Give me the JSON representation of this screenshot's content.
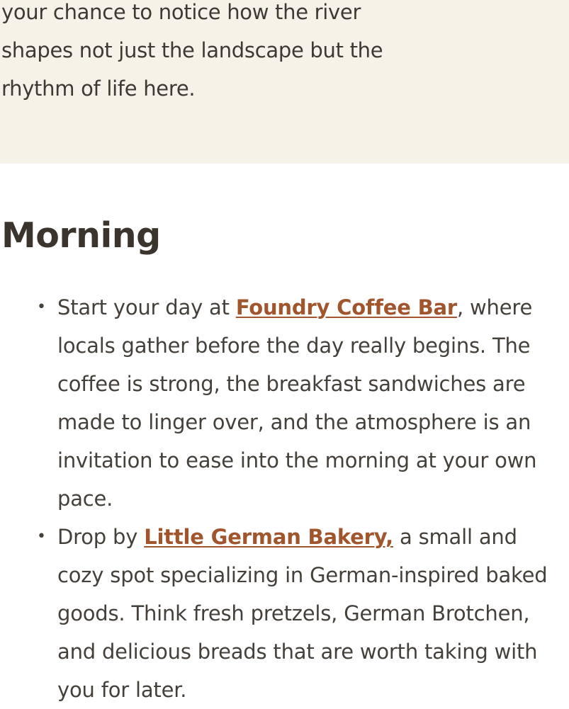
{
  "intro": {
    "text": "your chance to notice how the river shapes not just the landscape but the rhythm of life here."
  },
  "section": {
    "heading": "Morning",
    "items": [
      {
        "prefix": "Start your day at ",
        "link": "Foundry Coffee Bar",
        "suffix": ", where locals gather before the day really begins. The coffee is strong, the breakfast sandwiches are made to linger over, and the atmosphere is an invitation to ease into the morning at your own pace."
      },
      {
        "prefix": "Drop by ",
        "link": "Little German Bakery,",
        "suffix": " a small and cozy spot specializing in German-inspired baked goods. Think fresh pretzels, German Brotchen, and delicious breads that are worth taking with you for later."
      }
    ]
  },
  "colors": {
    "band_background": "#f7f2e8",
    "link": "#a0552d",
    "heading": "#3b342c",
    "body_text": "#45403a"
  }
}
